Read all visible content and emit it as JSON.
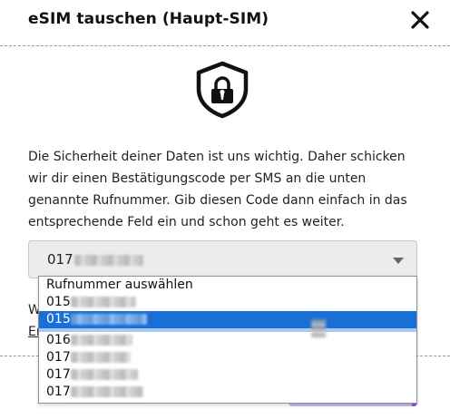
{
  "modal": {
    "title": "eSIM tauschen (Haupt-SIM)",
    "close_icon": "close-icon",
    "security_icon": "shield-lock-icon"
  },
  "paragraph": {
    "lines": [
      "Die Sicherheit deiner Daten ist uns wichtig. Daher schicken",
      "wir dir einen Bestätigungscode per SMS an die unten",
      "genannte Rufnummer. Gib diesen Code dann einfach in das",
      "entsprechende Feld ein und schon geht es weiter."
    ]
  },
  "phone_select": {
    "value_prefix": "017",
    "caret_icon": "chevron-down-icon"
  },
  "partially_hidden": {
    "line1_start": "W",
    "line2_start": "Er"
  },
  "dropdown": {
    "options": [
      {
        "label": "Rufnummer auswählen",
        "prefix": "",
        "masked": false
      },
      {
        "label": "",
        "prefix": "015",
        "masked": true
      },
      {
        "label": "",
        "prefix": "015",
        "masked": true,
        "selected": true
      },
      {
        "label": "",
        "prefix": "016",
        "masked": true
      },
      {
        "label": "",
        "prefix": "017",
        "masked": true
      },
      {
        "label": "",
        "prefix": "017",
        "masked": true
      },
      {
        "label": "",
        "prefix": "017",
        "masked": true
      }
    ]
  },
  "colors": {
    "selected_option": "#1a6fd6",
    "accent_button": "#8a52d6"
  }
}
